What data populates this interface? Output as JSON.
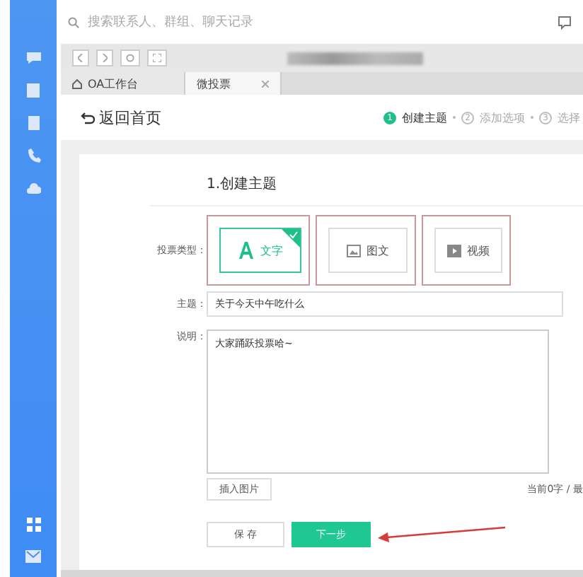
{
  "search": {
    "placeholder": "搜索联系人、群组、聊天记录"
  },
  "tabs": [
    {
      "label": "OA工作台",
      "kind": "home",
      "selected": false
    },
    {
      "label": "微投票",
      "kind": "page",
      "selected": true
    }
  ],
  "header": {
    "back": "返回首页",
    "steps": [
      {
        "number": "1",
        "label": "创建主题",
        "selected": true
      },
      {
        "number": "2",
        "label": "添加选项",
        "selected": false
      },
      {
        "number": "3",
        "label": "选择",
        "selected": false
      }
    ]
  },
  "form": {
    "section_title": "1.创建主题",
    "type_label": "投票类型：",
    "types": [
      {
        "label": "文字",
        "kind": "text",
        "selected": true
      },
      {
        "label": "图文",
        "kind": "image",
        "selected": false
      },
      {
        "label": "视频",
        "kind": "video",
        "selected": false
      }
    ],
    "topic_label": "主题：",
    "topic_value": "关于今天中午吃什么",
    "desc_label": "说明：",
    "desc_value": "大家踊跃投票哈~",
    "insert_image": "插入图片",
    "counter": "当前0字 / 最",
    "buttons": [
      {
        "label": "保 存",
        "kind": "secondary"
      },
      {
        "label": "下一步",
        "kind": "primary"
      }
    ]
  }
}
